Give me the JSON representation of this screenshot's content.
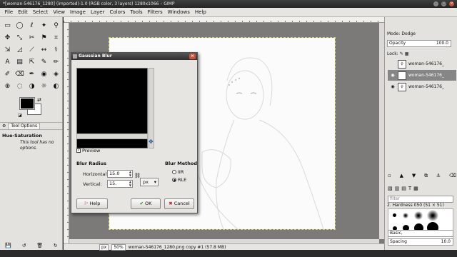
{
  "window": {
    "title": "*[woman-546176_1280] (imported)-1.0 (RGB color, 3 layers) 1280x1066 – GIMP",
    "buttons": [
      "–",
      "□",
      "×"
    ]
  },
  "menu": [
    "File",
    "Edit",
    "Select",
    "View",
    "Image",
    "Layer",
    "Colors",
    "Tools",
    "Filters",
    "Windows",
    "Help"
  ],
  "toolbox": {
    "tools": [
      "▭",
      "◯",
      "ℓ",
      "✦",
      "⚲",
      "✥",
      "⤡",
      "✂",
      "⚑",
      "⌗",
      "⇲",
      "◿",
      "⟋",
      "↔",
      "⚕",
      "A",
      "▤",
      "⇱",
      "✎",
      "✏",
      "✐",
      "⌫",
      "✒",
      "◉",
      "◈",
      "⊕",
      "◌",
      "◑",
      "☼",
      "◐"
    ],
    "options_tabs": [
      "Tool Options"
    ],
    "tool_name": "Hue-Saturation",
    "note": "This tool has no options.",
    "bottom_icons": [
      "💾",
      "↺",
      "🗑",
      "↻"
    ]
  },
  "dialog": {
    "title": "Gaussian Blur",
    "close_glyph": "×",
    "preview_label": "Preview",
    "preview_checked": true,
    "blur_radius_heading": "Blur Radius",
    "horizontal_label": "Horizontal:",
    "horizontal_value": "15.0",
    "vertical_label": "Vertical:",
    "vertical_value": "15.",
    "unit": "px",
    "blur_method_heading": "Blur Method",
    "methods": [
      {
        "label": "IIR",
        "selected": false
      },
      {
        "label": "RLE",
        "selected": true
      }
    ],
    "help_label": "Help",
    "ok_label": "OK",
    "cancel_label": "Cancel"
  },
  "status": {
    "unit": "px",
    "zoom": "50%",
    "info": "woman-546176_1280.png copy #1 (57.8 MB)"
  },
  "dock": {
    "mode_label": "Mode:",
    "mode_value": "Dodge",
    "opacity_label": "Opacity",
    "opacity_value": "100.0",
    "lock_label": "Lock:",
    "layers": [
      {
        "name": "woman-546176_",
        "visible": false,
        "selected": false
      },
      {
        "name": "woman-546176_",
        "visible": true,
        "selected": true
      },
      {
        "name": "woman-546176_",
        "visible": true,
        "selected": false
      }
    ],
    "filter_placeholder": "filter",
    "brush_name": "2. Hardness 050 (51 × 51)",
    "brush_set": "Basic,",
    "spacing_label": "Spacing",
    "spacing_value": "10.0"
  }
}
